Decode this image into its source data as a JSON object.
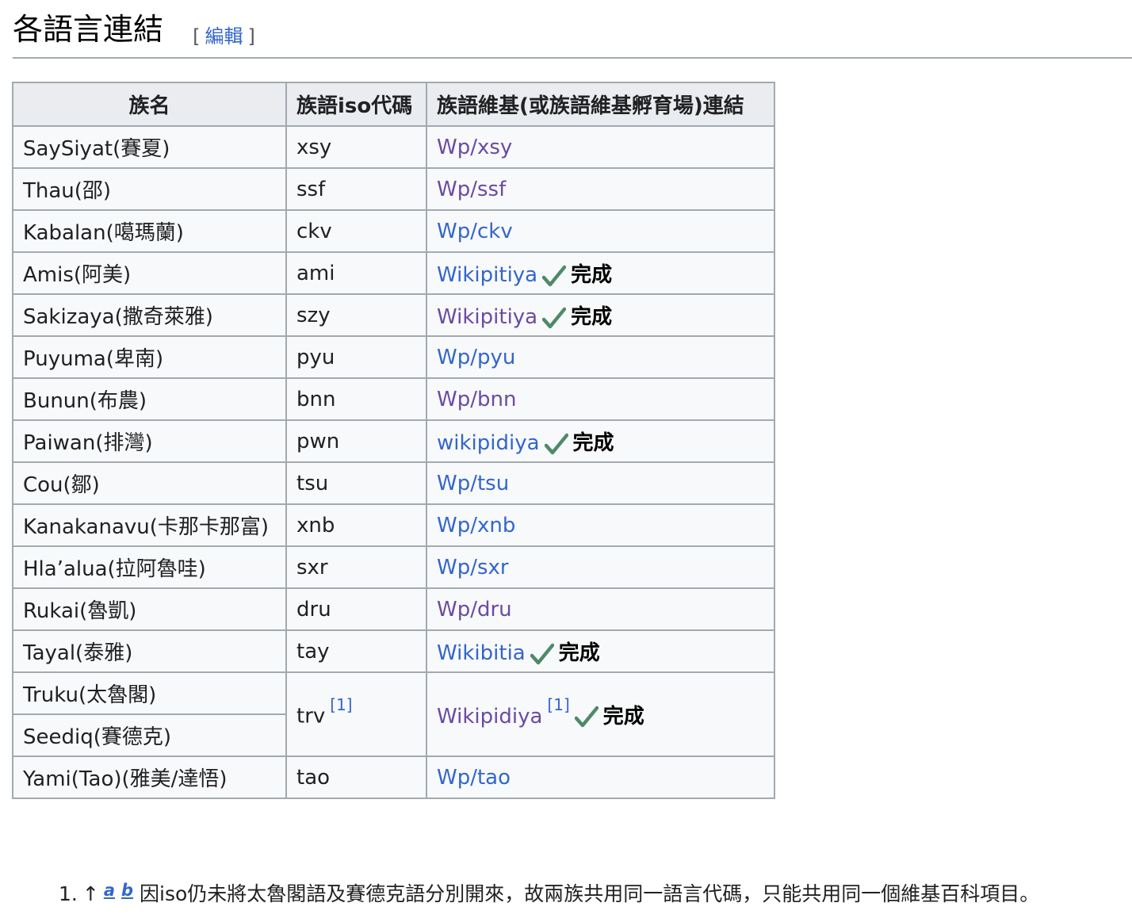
{
  "section": {
    "title": "各語言連結",
    "edit_open": "[",
    "edit_label": "編輯",
    "edit_close": "]"
  },
  "table": {
    "headers": [
      "族名",
      "族語iso代碼",
      "族語維基(或族語維基孵育場)連結"
    ],
    "done_label": "完成",
    "rows": [
      {
        "name": "SaySiyat(賽夏)",
        "iso": "xsy",
        "link": "Wp/xsy",
        "visited": true,
        "done": false
      },
      {
        "name": "Thau(邵)",
        "iso": "ssf",
        "link": "Wp/ssf",
        "visited": true,
        "done": false
      },
      {
        "name": "Kabalan(噶瑪蘭)",
        "iso": "ckv",
        "link": "Wp/ckv",
        "visited": false,
        "done": false
      },
      {
        "name": "Amis(阿美)",
        "iso": "ami",
        "link": "Wikipitiya",
        "visited": false,
        "done": true
      },
      {
        "name": "Sakizaya(撒奇萊雅)",
        "iso": "szy",
        "link": "Wikipitiya",
        "visited": true,
        "done": true
      },
      {
        "name": "Puyuma(卑南)",
        "iso": "pyu",
        "link": "Wp/pyu",
        "visited": false,
        "done": false
      },
      {
        "name": "Bunun(布農)",
        "iso": "bnn",
        "link": "Wp/bnn",
        "visited": true,
        "done": false
      },
      {
        "name": "Paiwan(排灣)",
        "iso": "pwn",
        "link": "wikipidiya",
        "visited": false,
        "done": true
      },
      {
        "name": "Cou(鄒)",
        "iso": "tsu",
        "link": "Wp/tsu",
        "visited": false,
        "done": false
      },
      {
        "name": "Kanakanavu(卡那卡那富)",
        "iso": "xnb",
        "link": "Wp/xnb",
        "visited": false,
        "done": false
      },
      {
        "name": "Hla’alua(拉阿魯哇)",
        "iso": "sxr",
        "link": "Wp/sxr",
        "visited": false,
        "done": false
      },
      {
        "name": "Rukai(魯凱)",
        "iso": "dru",
        "link": "Wp/dru",
        "visited": true,
        "done": false
      },
      {
        "name": "Tayal(泰雅)",
        "iso": "tay",
        "link": "Wikibitia",
        "visited": false,
        "done": true
      }
    ],
    "merged": {
      "names": [
        "Truku(太魯閣)",
        "Seediq(賽德克)"
      ],
      "iso": "trv",
      "iso_ref": "[1]",
      "link": "Wikipidiya",
      "link_ref": "[1]",
      "visited": true,
      "done": true
    },
    "last_row": {
      "name": "Yami(Tao)(雅美/達悟)",
      "iso": "tao",
      "link": "Wp/tao",
      "visited": false,
      "done": false
    }
  },
  "references": {
    "number": "1.",
    "caret": "↑",
    "backlink_a": "a",
    "backlink_b": "b",
    "text": "因iso仍未將太魯閣語及賽德克語分別開來，故兩族共用同一語言代碼，只能共用同一個維基百科項目。"
  },
  "colors": {
    "link": "#3366cc",
    "visited": "#6b4ba1",
    "check": "#4e8a6a",
    "border": "#a2a9b1"
  }
}
